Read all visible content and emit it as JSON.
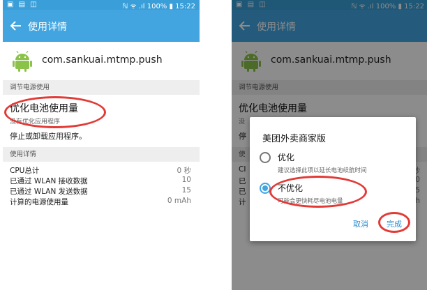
{
  "status_bar": {
    "left_icons": "▣ ▤ ◫",
    "right_text": "ℕ ᯤ .ıl 100% ▮ 15:22"
  },
  "app_bar": {
    "title": "使用详情"
  },
  "app": {
    "package_name": "com.sankuai.mtmp.push"
  },
  "power_section": {
    "header": "调节电源使用",
    "optimize_title": "优化电池使用量",
    "optimize_subtitle": "没有优化应用程序",
    "stop_text": "停止或卸载应用程序。"
  },
  "usage_section": {
    "header": "使用详情",
    "rows": [
      {
        "label": "CPU总计",
        "value": "0 秒"
      },
      {
        "label": "已通过 WLAN 接收数据",
        "value": "10"
      },
      {
        "label": "已通过 WLAN 发送数据",
        "value": "15"
      },
      {
        "label": "计算的电源使用量",
        "value": "0 mAh"
      }
    ]
  },
  "right_fragments": {
    "subtitle_partial": "没",
    "stop_partial": "停",
    "usage_partial": "使",
    "usage_labels_partial": [
      "CI",
      "已",
      "已",
      "计"
    ],
    "usage_values_partial": [
      "秒",
      "10",
      "15",
      "h"
    ]
  },
  "dialog": {
    "title": "美团外卖商家版",
    "options": [
      {
        "label": "优化",
        "description": "建议选择此项以延长电池续航时间",
        "selected": false
      },
      {
        "label": "不优化",
        "description": "可能会更快耗尽电池电量",
        "selected": true
      }
    ],
    "cancel_label": "取消",
    "done_label": "完成"
  },
  "colors": {
    "app_bar": "#42a5e0",
    "status_bar": "#3a9ed8",
    "accent": "#2f8fd3",
    "annotation_red": "#e23a36"
  }
}
